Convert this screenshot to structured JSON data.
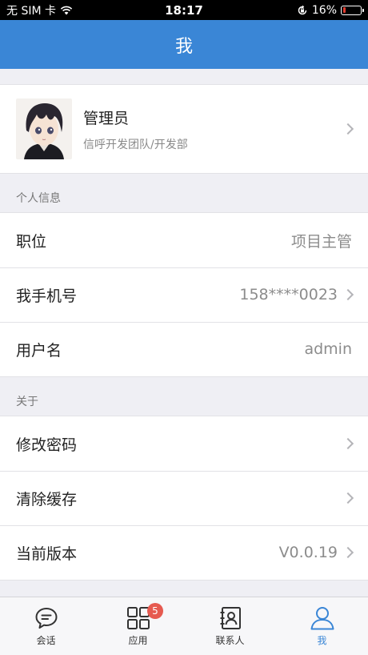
{
  "status_bar": {
    "carrier": "无 SIM 卡",
    "time": "18:17",
    "battery_percent": "16%",
    "battery_level": 0.16,
    "icons": [
      "wifi-icon",
      "orientation-lock-icon",
      "battery-icon"
    ]
  },
  "nav": {
    "title": "我"
  },
  "profile": {
    "name": "管理员",
    "org": "信呼开发团队/开发部"
  },
  "personal_section": {
    "header": "个人信息",
    "rows": [
      {
        "label": "职位",
        "value": "项目主管"
      },
      {
        "label": "我手机号",
        "value": "158****0023"
      },
      {
        "label": "用户名",
        "value": "admin"
      }
    ]
  },
  "about_section": {
    "header": "关于",
    "rows": [
      {
        "label": "修改密码",
        "value": ""
      },
      {
        "label": "清除缓存",
        "value": ""
      },
      {
        "label": "当前版本",
        "value": "V0.0.19"
      }
    ]
  },
  "tabs": [
    {
      "label": "会话",
      "icon": "chat-bubble-icon"
    },
    {
      "label": "应用",
      "icon": "grid-icon",
      "badge": "5"
    },
    {
      "label": "联系人",
      "icon": "contacts-icon"
    },
    {
      "label": "我",
      "icon": "person-icon"
    }
  ],
  "colors": {
    "accent": "#3a86d6",
    "badge": "#e65a50",
    "battery_low": "#e23b2e"
  }
}
